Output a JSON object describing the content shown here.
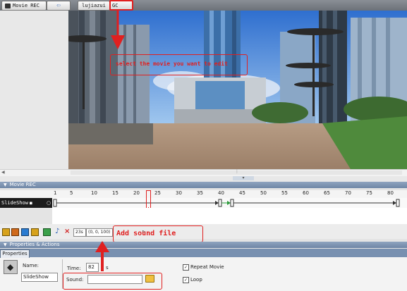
{
  "topbar": {
    "movie_tab": "Movie REC",
    "name_tab": "lujiazui",
    "gc_tab": "GC"
  },
  "annotations": {
    "select_movie": "select the movie you want to edit",
    "add_sound": "Add sound file"
  },
  "timeline": {
    "header": "Movie REC",
    "ruler": [
      "1",
      "5",
      "10",
      "15",
      "20",
      "25",
      "30",
      "35",
      "40",
      "45",
      "50",
      "55",
      "60",
      "65",
      "70",
      "75",
      "80"
    ],
    "track_label": "SlideShow",
    "time_readout": "23s",
    "coords_readout": "(0, 0, 100)"
  },
  "properties": {
    "header": "Properties & Actions",
    "tab": "Properties",
    "name_label": "Name:",
    "name_value": "SlideShow",
    "time_label": "Time:",
    "time_value": "82",
    "time_unit": "s",
    "sound_label": "Sound:",
    "sound_value": "",
    "repeat_label": "Repeat Movie",
    "loop_label": "Loop"
  },
  "colors": {
    "annotation": "#e02020",
    "header": "#7b90ad"
  }
}
